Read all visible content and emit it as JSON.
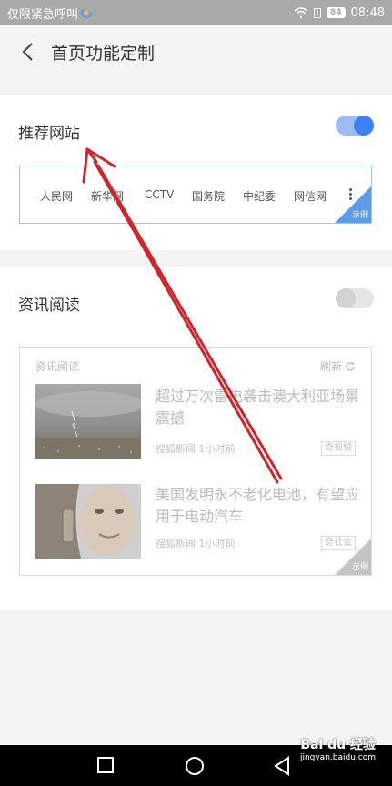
{
  "status_bar": {
    "left_text": "仅限紧急呼叫",
    "battery": "84",
    "sim": "1",
    "time": "08:48"
  },
  "header": {
    "title": "首页功能定制"
  },
  "recommended_sites": {
    "title": "推荐网站",
    "enabled": true,
    "sites": [
      "人民网",
      "新华网",
      "CCTV",
      "国务院",
      "中纪委",
      "网信网"
    ],
    "example_label": "示例"
  },
  "news_reading": {
    "title": "资讯阅读",
    "enabled": false,
    "preview_label": "资讯阅读",
    "refresh_label": "刷新",
    "items": [
      {
        "title": "超过万次雷电袭击澳大利亚场景震撼",
        "source": "搜狐新闻",
        "time": "1小时前",
        "tag": "奇视频"
      },
      {
        "title": "美国发明永不老化电池，有望应用于电动汽车",
        "source": "搜狐新闻",
        "time": "1小时前",
        "tag": "奇社会"
      }
    ],
    "example_label": "示例"
  },
  "watermark": {
    "brand": "Bai du 经验",
    "url": "jingyan.baidu.com"
  },
  "colors": {
    "accent": "#3b82f6",
    "annotation_arrow": "#d0252b"
  }
}
